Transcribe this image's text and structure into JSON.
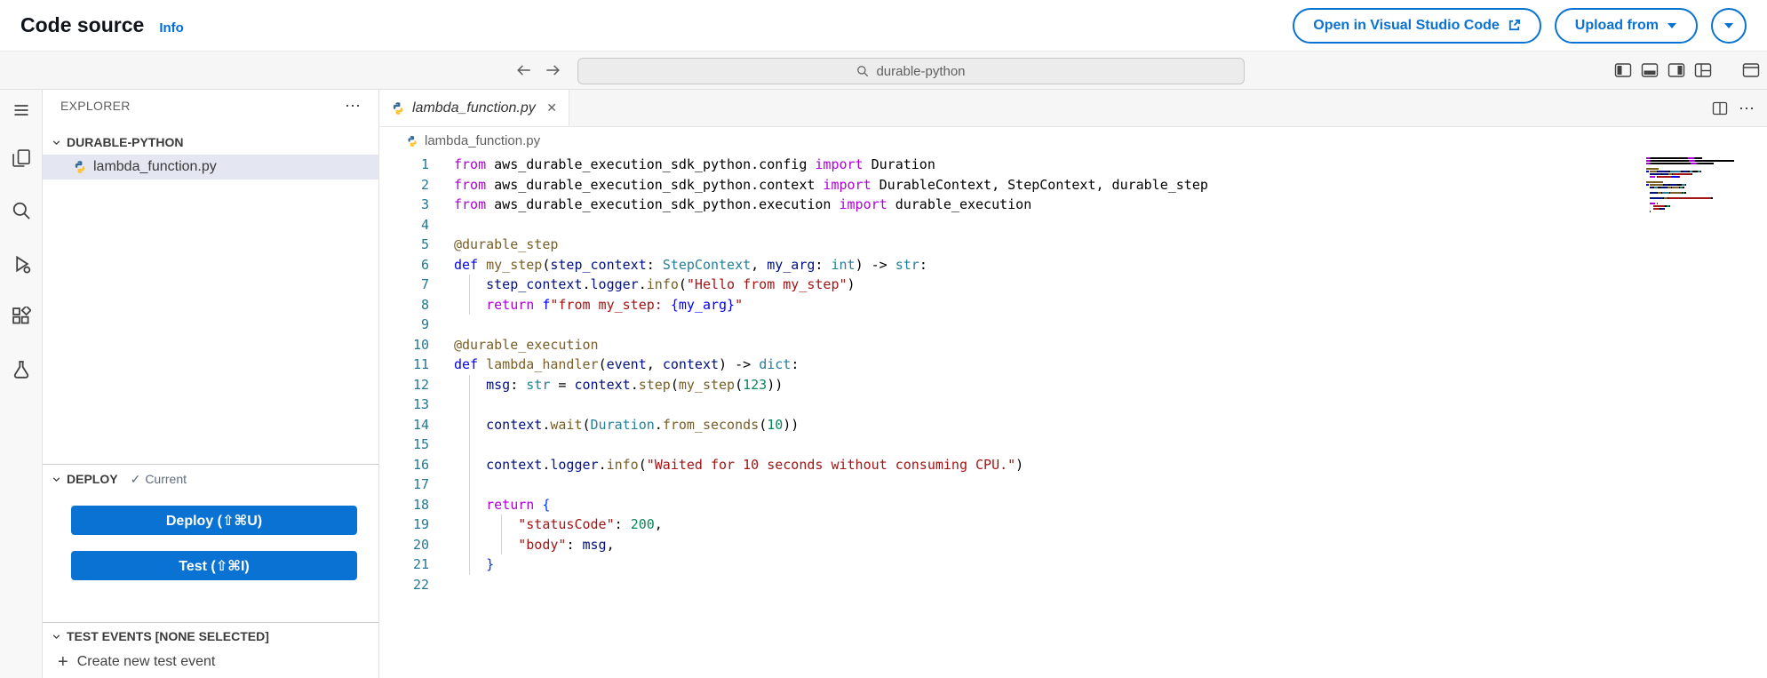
{
  "header": {
    "title": "Code source",
    "info_link": "Info",
    "buttons": {
      "open_vscode": "Open in Visual Studio Code",
      "upload_from": "Upload from"
    },
    "accent_color": "#0972d3"
  },
  "toolbar": {
    "search_value": "durable-python",
    "icons": [
      "arrow-left",
      "arrow-right",
      "search",
      "panel-left",
      "panel-bottom",
      "panel-right",
      "customize-layout",
      "window"
    ]
  },
  "activity_bar": {
    "icons": [
      "menu",
      "files",
      "search",
      "run-debug",
      "extensions",
      "aws-toolkit"
    ]
  },
  "sidebar": {
    "explorer_title": "EXPLORER",
    "tree": {
      "section_label": "DURABLE-PYTHON",
      "files": [
        {
          "name": "lambda_function.py",
          "selected": true
        }
      ]
    },
    "deploy": {
      "section_label": "DEPLOY",
      "status_text": "Current",
      "deploy_button": "Deploy (⇧⌘U)",
      "test_button": "Test (⇧⌘I)"
    },
    "test_events": {
      "section_label": "TEST EVENTS [NONE SELECTED]",
      "create_action": "Create new test event"
    }
  },
  "editor": {
    "tab": {
      "name": "lambda_function.py"
    },
    "breadcrumb": "lambda_function.py",
    "syntax_colors": {
      "k": "#AF00DB",
      "d": "#0000FF",
      "f": "#795E26",
      "v": "#001080",
      "t": "#267F99",
      "s": "#A31515",
      "n": "#098658",
      "x": "#000000",
      "b": "#0000FF",
      "bb": "#0431FA"
    },
    "lines": [
      [
        [
          "from",
          "k"
        ],
        [
          " aws_durable_execution_sdk_python.config ",
          "x"
        ],
        [
          "import",
          "k"
        ],
        [
          " Duration",
          "x"
        ]
      ],
      [
        [
          "from",
          "k"
        ],
        [
          " aws_durable_execution_sdk_python.context ",
          "x"
        ],
        [
          "import",
          "k"
        ],
        [
          " DurableContext, StepContext, durable_step",
          "x"
        ]
      ],
      [
        [
          "from",
          "k"
        ],
        [
          " aws_durable_execution_sdk_python.execution ",
          "x"
        ],
        [
          "import",
          "k"
        ],
        [
          " durable_execution",
          "x"
        ]
      ],
      [],
      [
        [
          "@durable_step",
          "f"
        ]
      ],
      [
        [
          "def",
          "d"
        ],
        [
          " ",
          "x"
        ],
        [
          "my_step",
          "f"
        ],
        [
          "(",
          "x"
        ],
        [
          "step_context",
          "v"
        ],
        [
          ": ",
          "x"
        ],
        [
          "StepContext",
          "t"
        ],
        [
          ", ",
          "x"
        ],
        [
          "my_arg",
          "v"
        ],
        [
          ": ",
          "x"
        ],
        [
          "int",
          "t"
        ],
        [
          ") -> ",
          "x"
        ],
        [
          "str",
          "t"
        ],
        [
          ":",
          "x"
        ]
      ],
      [
        [
          "    ",
          "x"
        ],
        [
          "step_context",
          "v"
        ],
        [
          ".",
          "x"
        ],
        [
          "logger",
          "v"
        ],
        [
          ".",
          "x"
        ],
        [
          "info",
          "f"
        ],
        [
          "(",
          "x"
        ],
        [
          "\"Hello from my_step\"",
          "s"
        ],
        [
          ")",
          "x"
        ]
      ],
      [
        [
          "    ",
          "x"
        ],
        [
          "return",
          "k"
        ],
        [
          " ",
          "x"
        ],
        [
          "f",
          "b"
        ],
        [
          "\"from my_step: ",
          "s"
        ],
        [
          "{my_arg}",
          "b"
        ],
        [
          "\"",
          "s"
        ]
      ],
      [],
      [
        [
          "@durable_execution",
          "f"
        ]
      ],
      [
        [
          "def",
          "d"
        ],
        [
          " ",
          "x"
        ],
        [
          "lambda_handler",
          "f"
        ],
        [
          "(",
          "x"
        ],
        [
          "event",
          "v"
        ],
        [
          ", ",
          "x"
        ],
        [
          "context",
          "v"
        ],
        [
          ") -> ",
          "x"
        ],
        [
          "dict",
          "t"
        ],
        [
          ":",
          "x"
        ]
      ],
      [
        [
          "    ",
          "x"
        ],
        [
          "msg",
          "v"
        ],
        [
          ": ",
          "x"
        ],
        [
          "str",
          "t"
        ],
        [
          " = ",
          "x"
        ],
        [
          "context",
          "v"
        ],
        [
          ".",
          "x"
        ],
        [
          "step",
          "f"
        ],
        [
          "(",
          "x"
        ],
        [
          "my_step",
          "f"
        ],
        [
          "(",
          "x"
        ],
        [
          "123",
          "n"
        ],
        [
          "))",
          "x"
        ]
      ],
      [],
      [
        [
          "    ",
          "x"
        ],
        [
          "context",
          "v"
        ],
        [
          ".",
          "x"
        ],
        [
          "wait",
          "f"
        ],
        [
          "(",
          "x"
        ],
        [
          "Duration",
          "t"
        ],
        [
          ".",
          "x"
        ],
        [
          "from_seconds",
          "f"
        ],
        [
          "(",
          "x"
        ],
        [
          "10",
          "n"
        ],
        [
          "))",
          "x"
        ]
      ],
      [],
      [
        [
          "    ",
          "x"
        ],
        [
          "context",
          "v"
        ],
        [
          ".",
          "x"
        ],
        [
          "logger",
          "v"
        ],
        [
          ".",
          "x"
        ],
        [
          "info",
          "f"
        ],
        [
          "(",
          "x"
        ],
        [
          "\"Waited for 10 seconds without consuming CPU.\"",
          "s"
        ],
        [
          ")",
          "x"
        ]
      ],
      [],
      [
        [
          "    ",
          "x"
        ],
        [
          "return",
          "k"
        ],
        [
          " ",
          "x"
        ],
        [
          "{",
          "bb"
        ]
      ],
      [
        [
          "        ",
          "x"
        ],
        [
          "\"statusCode\"",
          "s"
        ],
        [
          ": ",
          "x"
        ],
        [
          "200",
          "n"
        ],
        [
          ",",
          "x"
        ]
      ],
      [
        [
          "        ",
          "x"
        ],
        [
          "\"body\"",
          "s"
        ],
        [
          ": ",
          "x"
        ],
        [
          "msg",
          "v"
        ],
        [
          ",",
          "x"
        ]
      ],
      [
        [
          "    ",
          "x"
        ],
        [
          "}",
          "bb"
        ]
      ],
      []
    ]
  }
}
